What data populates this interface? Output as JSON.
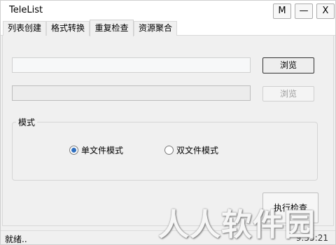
{
  "window": {
    "title": "TeleList",
    "buttons": {
      "m": "M",
      "minimize": "—",
      "close": "X"
    }
  },
  "tabs": [
    {
      "label": "列表创建"
    },
    {
      "label": "格式转换"
    },
    {
      "label": "重复检查",
      "selected": true
    },
    {
      "label": "资源聚合"
    }
  ],
  "panel": {
    "input1": {
      "value": "",
      "placeholder": ""
    },
    "input2": {
      "value": "",
      "placeholder": ""
    },
    "browse1": "浏览",
    "browse2": "浏览",
    "mode_group": {
      "title": "模式",
      "options": [
        {
          "label": "单文件模式",
          "checked": true
        },
        {
          "label": "双文件模式",
          "checked": false
        }
      ]
    },
    "execute": "执行检查"
  },
  "status": {
    "text": "就绪..",
    "time": "9:55:21"
  },
  "watermark": "人人软件园",
  "colors": {
    "radio_checked": "#2f6fbf",
    "disabled_text": "#9c9c9c"
  }
}
